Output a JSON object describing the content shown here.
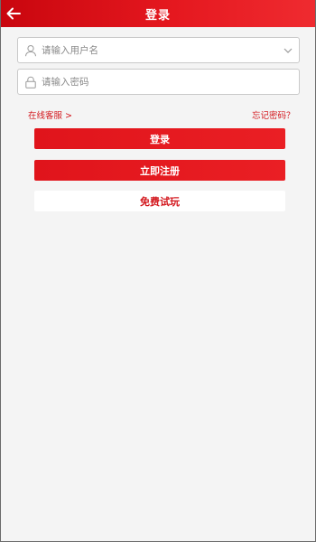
{
  "header": {
    "title": "登录",
    "back_icon": "arrow-left-icon",
    "bg_color": "#e5181f"
  },
  "form": {
    "username": {
      "placeholder": "请输入用户名",
      "icon": "user-icon",
      "dropdown_icon": "chevron-down-icon"
    },
    "password": {
      "placeholder": "请输入密码",
      "icon": "lock-icon"
    }
  },
  "links": {
    "online_service": "在线客服 >",
    "forgot_password": "忘记密码？"
  },
  "buttons": {
    "login": "登录",
    "register": "立即注册",
    "free_trial": "免费试玩"
  },
  "colors": {
    "accent": "#d3171d",
    "background": "#f4f4f4"
  }
}
